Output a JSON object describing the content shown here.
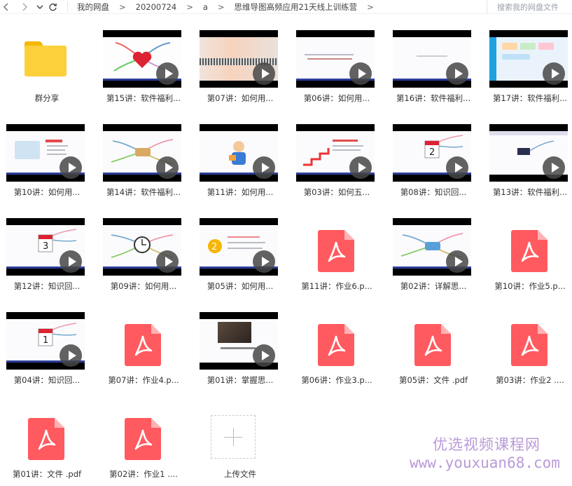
{
  "topbar": {
    "back_icon": "chevron-left-icon",
    "forward_icon": "chevron-right-icon",
    "dropdown_icon": "chevron-down-icon",
    "refresh_icon": "refresh-icon",
    "breadcrumb": [
      "我的网盘",
      "20200724",
      "a",
      "思维导图高频应用21天线上训练营"
    ],
    "separator": ">",
    "search_placeholder": "搜索我的网盘文件"
  },
  "files": [
    {
      "type": "folder",
      "name": "群分享"
    },
    {
      "type": "video",
      "name": "第15讲：软件福利...",
      "thumb": "heart"
    },
    {
      "type": "video",
      "name": "第07讲：如何用...",
      "thumb": "blur"
    },
    {
      "type": "video",
      "name": "第06讲：如何用...",
      "thumb": "text"
    },
    {
      "type": "video",
      "name": "第16讲：软件福利...",
      "thumb": "plain"
    },
    {
      "type": "video",
      "name": "第17讲：软件福利...",
      "thumb": "app"
    },
    {
      "type": "video",
      "name": "第10讲：如何用...",
      "thumb": "people"
    },
    {
      "type": "video",
      "name": "第14讲：软件福利...",
      "thumb": "mind"
    },
    {
      "type": "video",
      "name": "第11讲：如何用...",
      "thumb": "person"
    },
    {
      "type": "video",
      "name": "第03讲：如何五...",
      "thumb": "stairs"
    },
    {
      "type": "video",
      "name": "第08讲：知识回...",
      "thumb": "calendar2"
    },
    {
      "type": "video",
      "name": "第13讲：软件福利...",
      "thumb": "app2"
    },
    {
      "type": "video",
      "name": "第12讲：知识回...",
      "thumb": "calendar3"
    },
    {
      "type": "video",
      "name": "第09讲：如何用...",
      "thumb": "clock"
    },
    {
      "type": "video",
      "name": "第05讲：如何用...",
      "thumb": "number2"
    },
    {
      "type": "pdf",
      "name": "第11讲：作业6.p..."
    },
    {
      "type": "video",
      "name": "第02讲：详解思...",
      "thumb": "mind2"
    },
    {
      "type": "pdf",
      "name": "第10讲：作业5.p..."
    },
    {
      "type": "video",
      "name": "第04讲：知识回...",
      "thumb": "calendar1"
    },
    {
      "type": "pdf",
      "name": "第07讲：作业4.p..."
    },
    {
      "type": "video",
      "name": "第01讲：掌握思...",
      "thumb": "photo"
    },
    {
      "type": "pdf",
      "name": "第06讲：作业3.p..."
    },
    {
      "type": "pdf",
      "name": "第05讲：文件 .pdf"
    },
    {
      "type": "pdf",
      "name": "第03讲：作业2 ...."
    },
    {
      "type": "pdf",
      "name": "第01讲：文件 .pdf"
    },
    {
      "type": "pdf",
      "name": "第02讲：作业1 ...."
    },
    {
      "type": "upload",
      "name": "上传文件"
    }
  ],
  "watermark": {
    "line1": "优选视频课程网",
    "line2": "www.youxuan68.com"
  },
  "colors": {
    "folder": "#fcd03a",
    "pdf": "#ff5a5f",
    "watermark": "#b99ad8"
  }
}
